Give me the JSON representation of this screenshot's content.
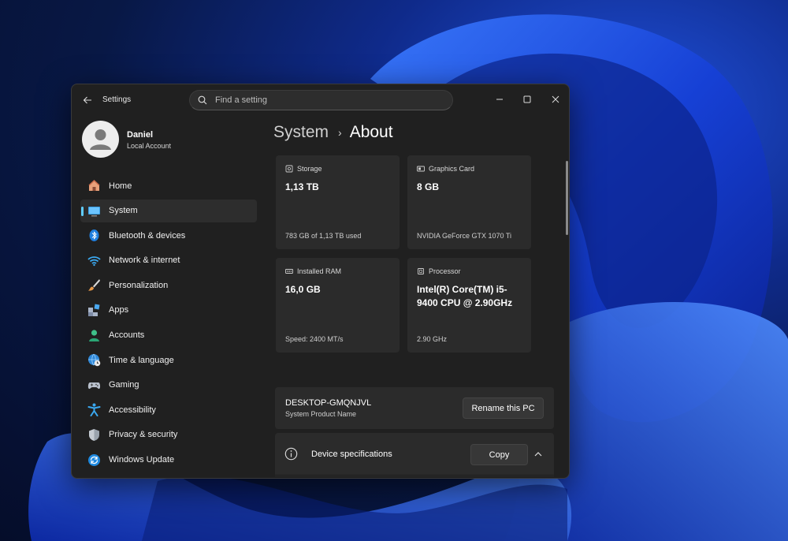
{
  "window": {
    "app_title": "Settings",
    "search_placeholder": "Find a setting"
  },
  "profile": {
    "name": "Daniel",
    "account_type": "Local Account"
  },
  "sidebar": {
    "items": [
      {
        "label": "Home",
        "icon": "home-icon",
        "active": false
      },
      {
        "label": "System",
        "icon": "monitor-icon",
        "active": true
      },
      {
        "label": "Bluetooth & devices",
        "icon": "bluetooth-icon",
        "active": false
      },
      {
        "label": "Network & internet",
        "icon": "wifi-icon",
        "active": false
      },
      {
        "label": "Personalization",
        "icon": "brush-icon",
        "active": false
      },
      {
        "label": "Apps",
        "icon": "apps-icon",
        "active": false
      },
      {
        "label": "Accounts",
        "icon": "person-icon",
        "active": false
      },
      {
        "label": "Time & language",
        "icon": "globe-clock-icon",
        "active": false
      },
      {
        "label": "Gaming",
        "icon": "gamepad-icon",
        "active": false
      },
      {
        "label": "Accessibility",
        "icon": "accessibility-icon",
        "active": false
      },
      {
        "label": "Privacy & security",
        "icon": "shield-icon",
        "active": false
      },
      {
        "label": "Windows Update",
        "icon": "update-icon",
        "active": false
      }
    ]
  },
  "breadcrumb": {
    "parent": "System",
    "separator": "›",
    "current": "About"
  },
  "cards": {
    "storage": {
      "label": "Storage",
      "value": "1,13 TB",
      "sub": "783 GB of 1,13 TB used",
      "icon": "storage-icon"
    },
    "graphics": {
      "label": "Graphics Card",
      "value": "8 GB",
      "sub": "NVIDIA GeForce GTX 1070 Ti",
      "icon": "gpu-icon"
    },
    "ram": {
      "label": "Installed RAM",
      "value": "16,0 GB",
      "sub": "Speed: 2400 MT/s",
      "icon": "ram-icon"
    },
    "processor": {
      "label": "Processor",
      "value": "Intel(R) Core(TM) i5-9400 CPU @ 2.90GHz",
      "sub": "2.90 GHz",
      "icon": "cpu-icon"
    }
  },
  "pc": {
    "name": "DESKTOP-GMQNJVL",
    "sub": "System Product Name",
    "rename_label": "Rename this PC"
  },
  "specs": {
    "label": "Device specifications",
    "copy_label": "Copy"
  },
  "colors": {
    "accent": "#60cdff",
    "window_bg": "#202020",
    "card_bg": "#2b2b2b"
  }
}
